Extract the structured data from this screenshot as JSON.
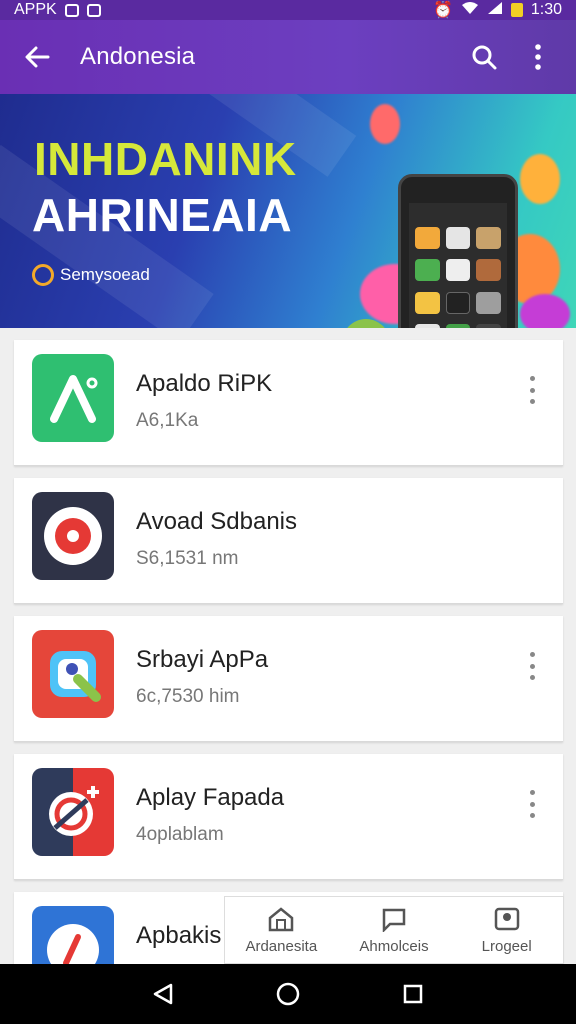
{
  "status_bar": {
    "left_text": "APPK",
    "time": "1:30"
  },
  "app_bar": {
    "title": "Andonesia",
    "back_icon": "arrow-left-icon",
    "search_icon": "search-icon",
    "menu_icon": "more-vert-icon"
  },
  "banner": {
    "headline_line1": "INHDANINK",
    "headline_line2": "AHRINEAIA",
    "brand": "Semysoead",
    "colors": {
      "accent": "#d6e83a",
      "brand_ring": "#f3a92a"
    }
  },
  "apps": [
    {
      "name": "Apaldo RiPK",
      "sub": "A6,1Ka",
      "icon": "green-arc-app-icon",
      "icon_color": "#2fbf71",
      "has_menu": true
    },
    {
      "name": "Avoad Sdbanis",
      "sub": "S6,1531 nm",
      "icon": "red-disc-app-icon",
      "icon_color": "#2f3347",
      "has_menu": false
    },
    {
      "name": "Srbayi ApPa",
      "sub": "6c,7530 him",
      "icon": "puzzle-app-icon",
      "icon_color": "#e5463a",
      "has_menu": true
    },
    {
      "name": "Aplay Fapada",
      "sub": "4oplablam",
      "icon": "target-plus-app-icon",
      "icon_color": "#2f3b5b",
      "has_menu": true
    },
    {
      "name": "Apbakis",
      "sub": "",
      "icon": "blue-clock-app-icon",
      "icon_color": "#2f74d6",
      "has_menu": false
    }
  ],
  "bottom_tabs": [
    {
      "label": "Ardanesita",
      "icon": "home-icon"
    },
    {
      "label": "Ahmolceis",
      "icon": "chat-icon"
    },
    {
      "label": "Lrogeel",
      "icon": "profile-icon"
    }
  ],
  "nav_bar": {
    "back_icon": "triangle-back-icon",
    "home_icon": "circle-home-icon",
    "recents_icon": "square-recents-icon"
  }
}
